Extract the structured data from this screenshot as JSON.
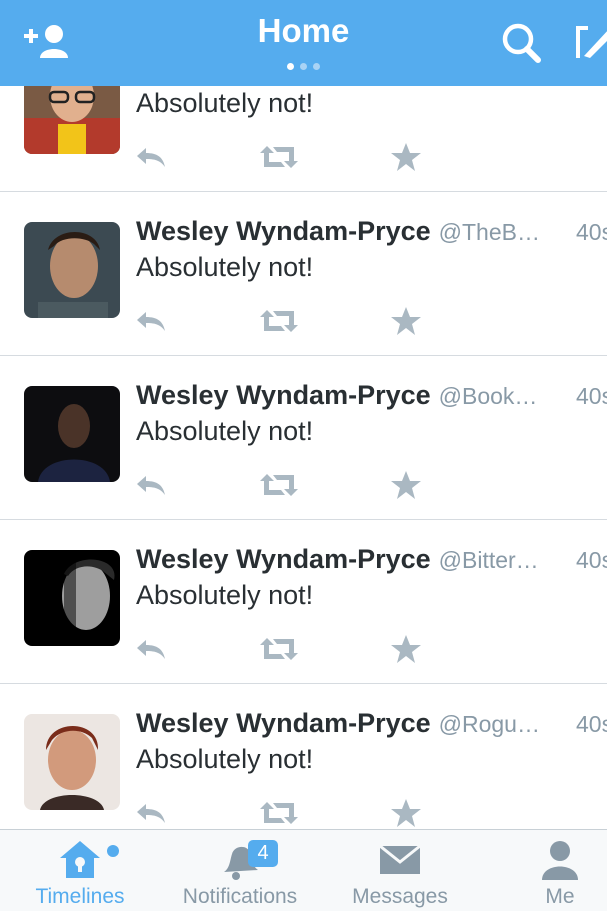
{
  "header": {
    "title": "Home",
    "page_dots": 3,
    "active_dot": 0,
    "accent_color": "#55acee",
    "icons": [
      "add-user-icon",
      "search-icon",
      "compose-icon"
    ]
  },
  "tweets": [
    {
      "name": "",
      "handle": "",
      "time": "",
      "text": "Absolutely not!"
    },
    {
      "name": "Wesley Wyndam-Pryce",
      "handle": "@TheB…",
      "time": "40s",
      "text": "Absolutely not!"
    },
    {
      "name": "Wesley Wyndam-Pryce",
      "handle": "@Book…",
      "time": "40s",
      "text": "Absolutely not!"
    },
    {
      "name": "Wesley Wyndam-Pryce",
      "handle": "@Bitter…",
      "time": "40s",
      "text": "Absolutely not!"
    },
    {
      "name": "Wesley Wyndam-Pryce",
      "handle": "@Rogu…",
      "time": "40s",
      "text": "Absolutely not!"
    }
  ],
  "tabbar": {
    "tabs": [
      {
        "label": "Timelines",
        "icon": "home-icon",
        "active": true,
        "has_dot": true
      },
      {
        "label": "Notifications",
        "icon": "bell-icon",
        "badge": "4"
      },
      {
        "label": "Messages",
        "icon": "envelope-icon"
      },
      {
        "label": "Me",
        "icon": "person-icon"
      }
    ]
  }
}
